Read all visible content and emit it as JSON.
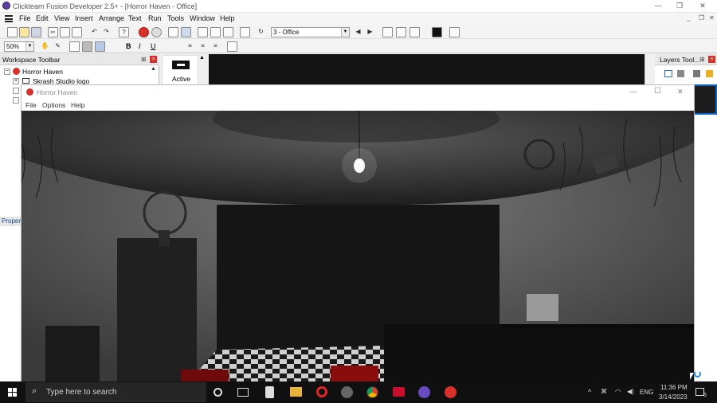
{
  "app": {
    "title": "Clickteam Fusion Developer 2.5+ - [Horror Haven - Office]",
    "window_controls": {
      "minimize": "—",
      "restore": "❐",
      "close": "✕"
    },
    "inner_controls": {
      "minimize": "_",
      "restore": "❐",
      "close": "✕"
    }
  },
  "menu": [
    "File",
    "Edit",
    "View",
    "Insert",
    "Arrange",
    "Text",
    "Run",
    "Tools",
    "Window",
    "Help"
  ],
  "toolbar": {
    "frame_select": "3 - Office",
    "zoom": "50%",
    "text_bold": "B",
    "text_italic": "I",
    "text_underline": "U"
  },
  "workspace": {
    "title": "Workspace Toolbar",
    "tree": {
      "root": "Horror Haven",
      "child": "Skrash Studio logo"
    }
  },
  "object_palette": {
    "item_label": "Active"
  },
  "layers": {
    "title": "Layers Tool..."
  },
  "properties_tab": "Proper",
  "game_window": {
    "title": "Horror Haven",
    "menu": [
      "File",
      "Options",
      "Help"
    ],
    "controls": {
      "minimize": "—",
      "maximize": "☐",
      "close": "✕"
    }
  },
  "taskbar": {
    "search_placeholder": "Type here to search",
    "language": "ENG",
    "time": "11:36 PM",
    "date": "3/14/2023",
    "notification_count": "6"
  },
  "colors": {
    "accent": "#0a64c8",
    "close_red": "#d9302a",
    "taskbar": "#101010",
    "scene_wall": "#5a5a5a",
    "scene_ceiling": "#2e2e2e"
  },
  "icons": [
    "app-logo-icon",
    "new-file-icon",
    "open-file-icon",
    "save-icon",
    "cut-icon",
    "copy-icon",
    "paste-icon",
    "undo-icon",
    "redo-icon",
    "help-icon",
    "stop-icon",
    "prev-frame-icon",
    "next-frame-icon",
    "hand-icon",
    "align-left-icon",
    "align-center-icon",
    "align-right-icon",
    "windows-start-icon",
    "search-icon",
    "task-view-icon",
    "chrome-icon",
    "opera-icon",
    "folder-icon"
  ]
}
